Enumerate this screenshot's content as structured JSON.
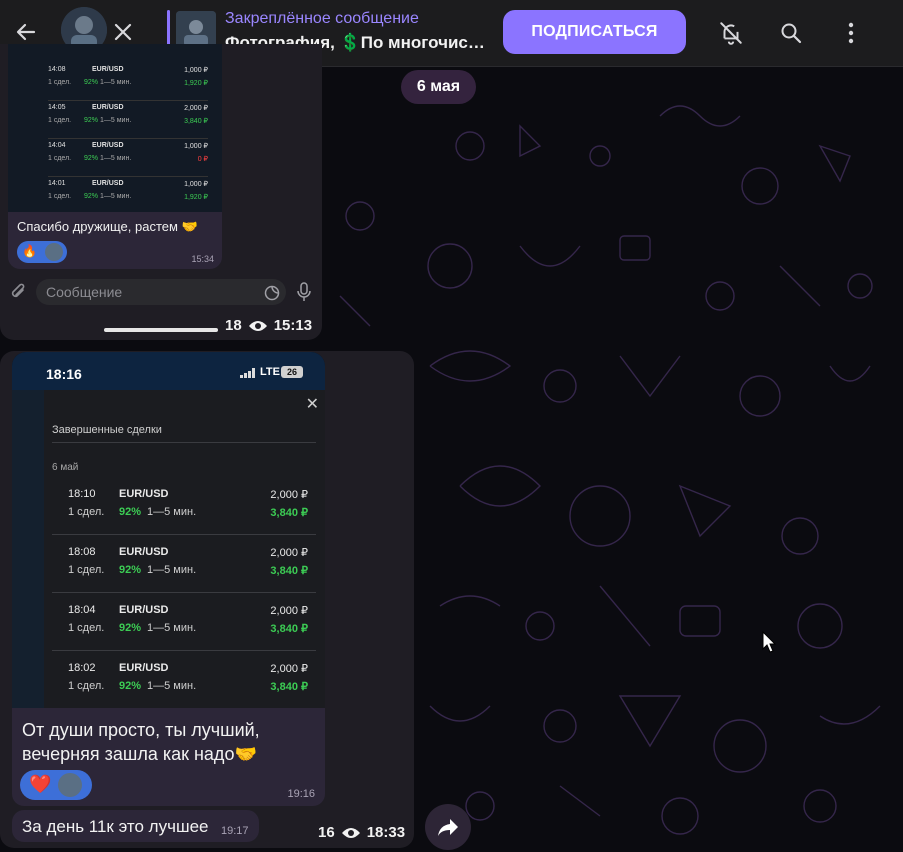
{
  "header": {
    "back_icon": "arrow-left-icon",
    "close_icon": "close-icon",
    "pinned_title": "Закреплённое сообщение",
    "pinned_text": "Фотография, 💲По многочис…",
    "subscribe_label": "ПОДПИСАТЬСЯ",
    "mute_icon": "bell-off-icon",
    "search_icon": "search-icon",
    "more_icon": "more-vertical-icon"
  },
  "date_badge": "6 мая",
  "post1": {
    "mini_trades": [
      {
        "time": "14:08",
        "pair": "EUR/USD",
        "amount": "1,000 ₽",
        "deals": "1 сдел.",
        "percent": "92%",
        "duration": "1—5 мин.",
        "result": "1,920 ₽",
        "result_color": "#3ccc54"
      },
      {
        "time": "14:05",
        "pair": "EUR/USD",
        "amount": "2,000 ₽",
        "deals": "1 сдел.",
        "percent": "92%",
        "duration": "1—5 мин.",
        "result": "3,840 ₽",
        "result_color": "#3ccc54"
      },
      {
        "time": "14:04",
        "pair": "EUR/USD",
        "amount": "1,000 ₽",
        "deals": "1 сдел.",
        "percent": "92%",
        "duration": "1—5 мин.",
        "result": "0 ₽",
        "result_color": "#ff4040"
      },
      {
        "time": "14:01",
        "pair": "EUR/USD",
        "amount": "1,000 ₽",
        "deals": "1 сдел.",
        "percent": "92%",
        "duration": "1—5 мин.",
        "result": "1,920 ₽",
        "result_color": "#3ccc54"
      }
    ],
    "comment": "Спасибо дружище, растем 🤝",
    "comment_time": "15:34",
    "reaction": "🔥",
    "input_placeholder": "Сообщение",
    "views": "18",
    "time": "15:13"
  },
  "post2": {
    "status_time": "18:16",
    "network": "LTE",
    "battery": "26",
    "modal_title": "Завершенные сделки",
    "modal_date": "6 май",
    "trades": [
      {
        "time": "18:10",
        "pair": "EUR/USD",
        "amount": "2,000 ₽",
        "deals": "1 сдел.",
        "percent": "92%",
        "duration": "1—5 мин.",
        "result": "3,840 ₽"
      },
      {
        "time": "18:08",
        "pair": "EUR/USD",
        "amount": "2,000 ₽",
        "deals": "1 сдел.",
        "percent": "92%",
        "duration": "1—5 мин.",
        "result": "3,840 ₽"
      },
      {
        "time": "18:04",
        "pair": "EUR/USD",
        "amount": "2,000 ₽",
        "deals": "1 сдел.",
        "percent": "92%",
        "duration": "1—5 мин.",
        "result": "3,840 ₽"
      },
      {
        "time": "18:02",
        "pair": "EUR/USD",
        "amount": "2,000 ₽",
        "deals": "1 сдел.",
        "percent": "92%",
        "duration": "1—5 мин.",
        "result": "3,840 ₽"
      }
    ],
    "caption": "От души просто, ты лучший, вечерняя зашла как надо🤝",
    "reaction": "❤️",
    "caption_time": "19:16",
    "msg3": "За день 11к это лучшее",
    "msg3_time": "19:17",
    "views": "16",
    "time": "18:33"
  },
  "colors": {
    "accent": "#8b74ff",
    "background": "#0b0b10",
    "bubble": "#2c2638",
    "profit_green": "#3ccc54"
  }
}
